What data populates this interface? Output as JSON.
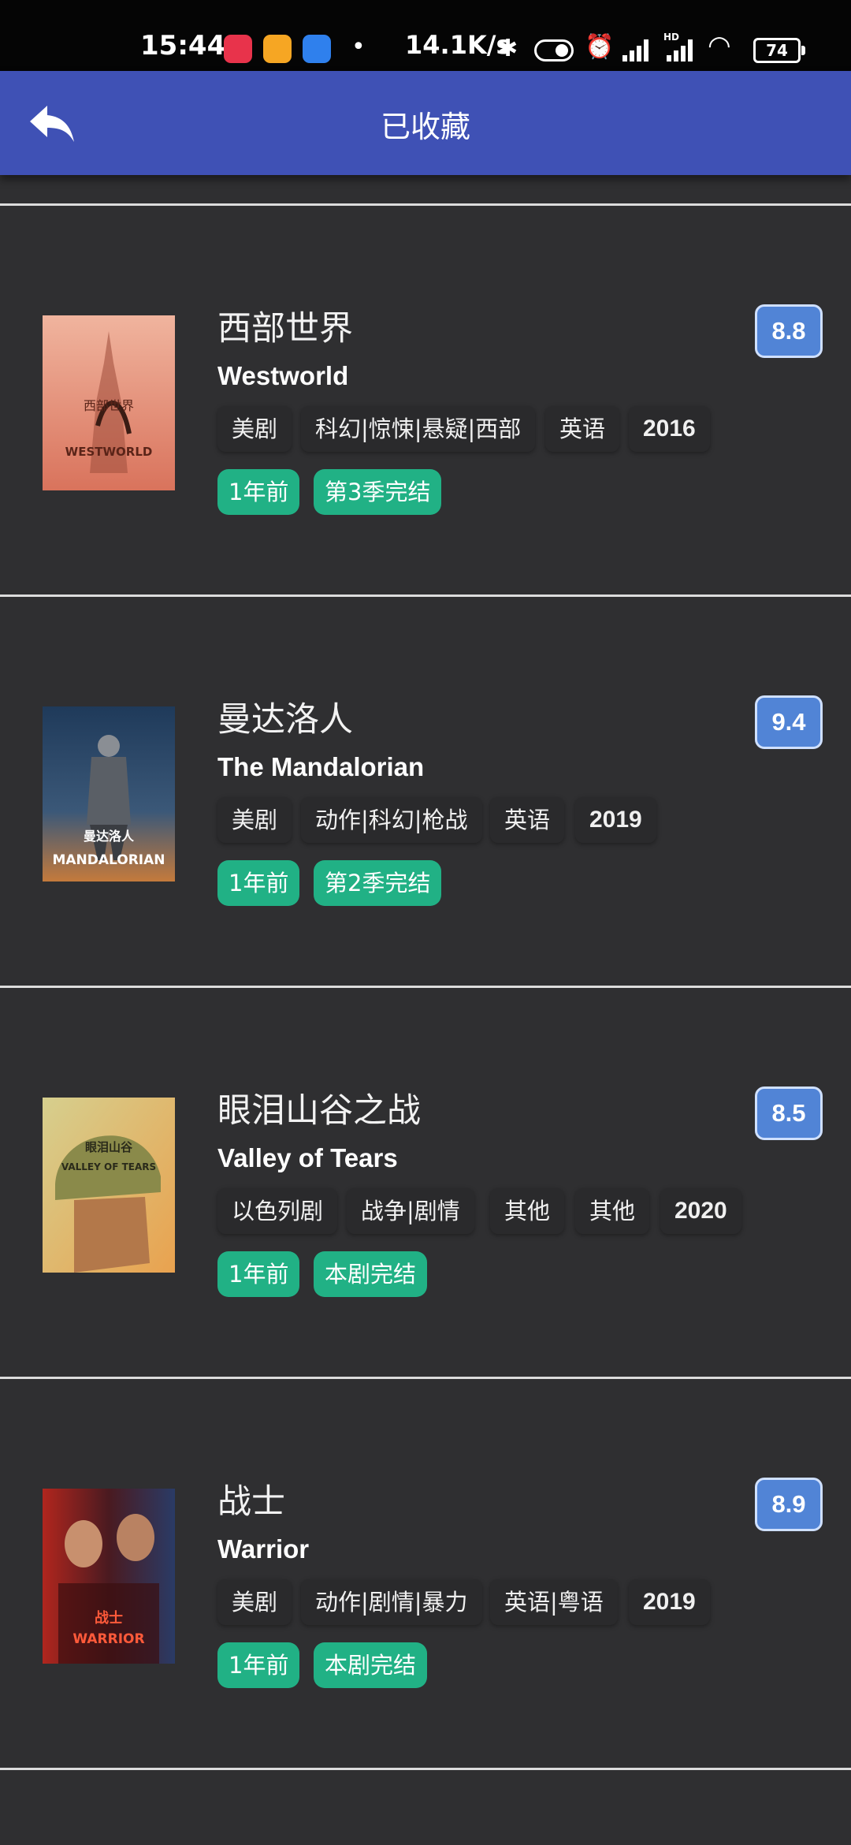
{
  "status_bar": {
    "time": "15:44",
    "dot": "•",
    "net_speed": "14.1K/s",
    "hd": "HD",
    "battery": "74"
  },
  "app_bar": {
    "title": "已收藏"
  },
  "items": [
    {
      "name_cn": "西部世界",
      "name_en": "Westworld",
      "rating": "8.8",
      "tags": [
        "美剧",
        "科幻|惊悚|悬疑|西部",
        "英语",
        "2016"
      ],
      "badges": [
        "1年前",
        "第3季完结"
      ],
      "poster": {
        "title_cn": "西部世界",
        "title_en": "WESTWORLD",
        "colors": [
          "#e8a08c",
          "#d36d59"
        ]
      }
    },
    {
      "name_cn": "曼达洛人",
      "name_en": "The Mandalorian",
      "rating": "9.4",
      "tags": [
        "美剧",
        "动作|科幻|枪战",
        "英语",
        "2019"
      ],
      "badges": [
        "1年前",
        "第2季完结"
      ],
      "poster": {
        "title_cn": "曼达洛人",
        "title_en": "MANDALORIAN",
        "colors": [
          "#2c4a6b",
          "#c47a3c"
        ]
      }
    },
    {
      "name_cn": "眼泪山谷之战",
      "name_en": "Valley of Tears",
      "rating": "8.5",
      "tags": [
        "以色列剧",
        "战争|剧情",
        "其他",
        "其他",
        "2020"
      ],
      "badges": [
        "1年前",
        "本剧完结"
      ],
      "poster": {
        "title_cn": "眼泪山谷",
        "title_en": "VALLEY OF TEARS",
        "colors": [
          "#c9c07a",
          "#8a7a3a"
        ]
      }
    },
    {
      "name_cn": "战士",
      "name_en": "Warrior",
      "rating": "8.9",
      "tags": [
        "美剧",
        "动作|剧情|暴力",
        "英语|粤语",
        "2019"
      ],
      "badges": [
        "1年前",
        "本剧完结"
      ],
      "poster": {
        "title_cn": "战士",
        "title_en": "WARRIOR",
        "colors": [
          "#b1261e",
          "#2a3b66"
        ]
      }
    }
  ]
}
